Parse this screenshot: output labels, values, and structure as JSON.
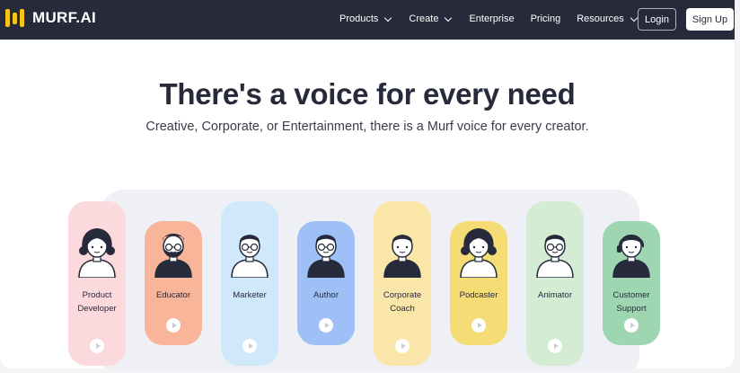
{
  "nav": {
    "logo_text": "MURF.AI",
    "menu": [
      {
        "label": "Products",
        "dropdown": true
      },
      {
        "label": "Create",
        "dropdown": true
      },
      {
        "label": "Enterprise",
        "dropdown": false
      },
      {
        "label": "Pricing",
        "dropdown": false
      },
      {
        "label": "Resources",
        "dropdown": true
      }
    ],
    "login_label": "Login",
    "signup_label": "Sign Up"
  },
  "hero": {
    "title": "There's a voice for every need",
    "subtitle": "Creative, Corporate, or Entertainment, there is a Murf voice for every creator."
  },
  "voices": [
    {
      "label": "Product Developer",
      "color": "#fbd9dc",
      "icon": "woman-curly-hair-avatar-icon"
    },
    {
      "label": "Educator",
      "color": "#f8b59a",
      "icon": "bearded-man-avatar-icon"
    },
    {
      "label": "Marketer",
      "color": "#cfe9fb",
      "icon": "man-glasses-avatar-icon"
    },
    {
      "label": "Author",
      "color": "#9fc0f6",
      "icon": "man-glasses-sweater-avatar-icon"
    },
    {
      "label": "Corporate Coach",
      "color": "#fbe6a9",
      "icon": "man-suit-avatar-icon"
    },
    {
      "label": "Podcaster",
      "color": "#f6dc75",
      "icon": "woman-curly-hair-mic-avatar-icon"
    },
    {
      "label": "Animator",
      "color": "#d4ecd4",
      "icon": "man-glasses-avatar-icon"
    },
    {
      "label": "Customer Support",
      "color": "#9fd6b2",
      "icon": "woman-headset-avatar-icon"
    }
  ],
  "colors": {
    "nav_bg": "#262a3a",
    "brand_yellow": "#f5c518"
  }
}
